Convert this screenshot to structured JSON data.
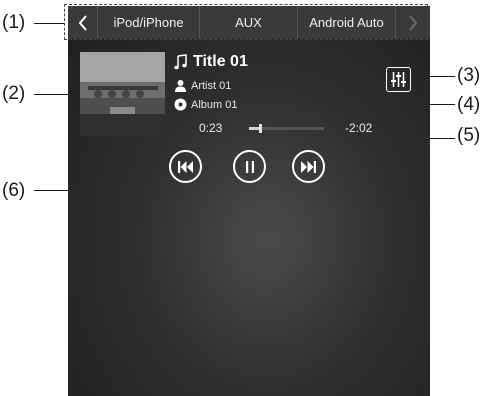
{
  "callouts": {
    "c1": "(1)",
    "c2": "(2)",
    "c3": "(3)",
    "c4": "(4)",
    "c5": "(5)",
    "c6": "(6)"
  },
  "tabs": {
    "back_icon": "chevron-left-icon",
    "items": [
      {
        "label": "iPod/iPhone"
      },
      {
        "label": "AUX"
      },
      {
        "label": "Android Auto"
      }
    ],
    "next_icon": "chevron-right-icon"
  },
  "track": {
    "title": "Title 01",
    "artist": "Artist 01",
    "album": "Album 01",
    "elapsed": "0:23",
    "remaining": "-2:02",
    "progress": 0.15
  },
  "icons": {
    "title": "music-note-icon",
    "artist": "person-icon",
    "album": "disc-icon",
    "eq": "equalizer-icon",
    "prev": "previous-track-icon",
    "pause": "pause-icon",
    "next": "next-track-icon"
  },
  "colors": {
    "screen_bg": "#2f2f2f",
    "tab_bar": "#3a3a3a",
    "text": "#ffffff"
  }
}
